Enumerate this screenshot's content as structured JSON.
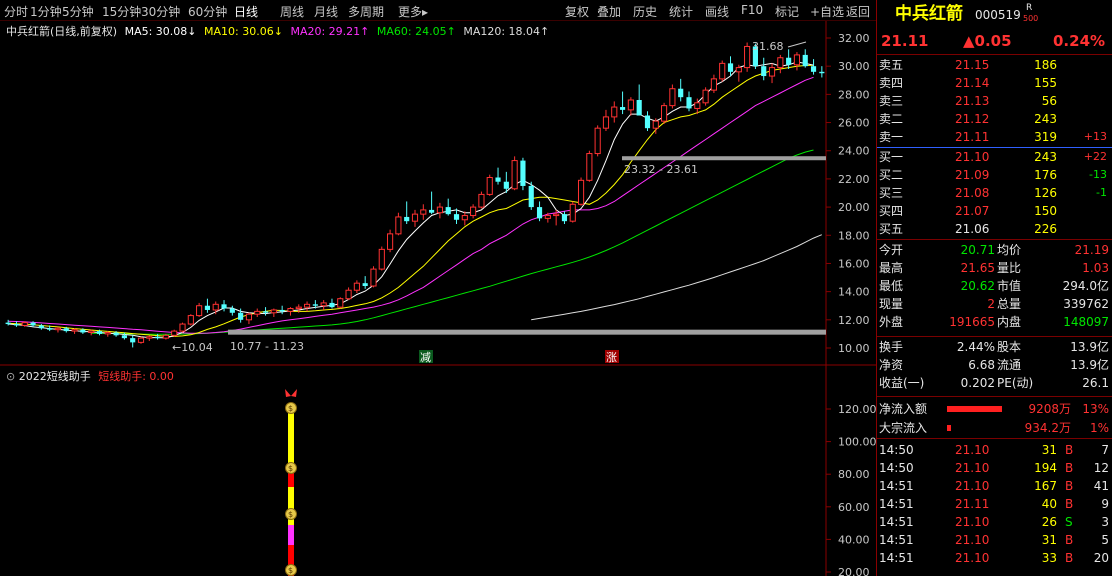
{
  "toolbar": {
    "periods": [
      "分时",
      "1分钟",
      "5分钟",
      "15分钟",
      "30分钟",
      "60分钟",
      "日线",
      "周线",
      "月线",
      "多周期",
      "更多▸"
    ],
    "active_period": "日线",
    "actions": [
      "复权",
      "叠加",
      "历史",
      "统计",
      "画线",
      "F10",
      "标记",
      "+自选",
      "返回"
    ]
  },
  "chart_header": {
    "name": "中兵红箭(日线,前复权)",
    "ma5": "MA5: 30.08↓",
    "ma10": "MA10: 30.06↓",
    "ma20": "MA20: 29.21↑",
    "ma60": "MA60: 24.05↑",
    "ma120": "MA120: 18.04↑"
  },
  "colors": {
    "ma5": "#ffffff",
    "ma10": "#ffff00",
    "ma20": "#ff32ff",
    "ma60": "#00e600",
    "ma120": "#dcdcdc",
    "up": "#ff3232",
    "down": "#54ffff",
    "grid": "#8a0000"
  },
  "price_axis": {
    "labels": [
      "32.00",
      "30.00",
      "28.00",
      "26.00",
      "24.00",
      "22.00",
      "20.00",
      "18.00",
      "16.00",
      "14.00",
      "12.00",
      "10.00"
    ]
  },
  "annotations": {
    "high_label": "31.68",
    "low_label": "10.04",
    "band_low": "10.77 - 11.23",
    "band_high": "23.32 - 23.61",
    "signal_decrease": "减",
    "signal_increase": "涨"
  },
  "candles": [
    [
      11.8,
      12.0,
      11.6,
      11.7
    ],
    [
      11.7,
      11.9,
      11.5,
      11.6
    ],
    [
      11.6,
      11.9,
      11.5,
      11.8
    ],
    [
      11.8,
      11.9,
      11.5,
      11.6
    ],
    [
      11.6,
      11.7,
      11.3,
      11.4
    ],
    [
      11.4,
      11.6,
      11.2,
      11.3
    ],
    [
      11.3,
      11.5,
      11.1,
      11.4
    ],
    [
      11.4,
      11.5,
      11.1,
      11.2
    ],
    [
      11.2,
      11.4,
      11.0,
      11.3
    ],
    [
      11.3,
      11.4,
      11.0,
      11.1
    ],
    [
      11.1,
      11.3,
      10.9,
      11.2
    ],
    [
      11.2,
      11.3,
      10.9,
      11.0
    ],
    [
      11.0,
      11.2,
      10.8,
      11.1
    ],
    [
      11.1,
      11.2,
      10.8,
      10.9
    ],
    [
      10.9,
      11.1,
      10.6,
      10.7
    ],
    [
      10.7,
      10.9,
      10.04,
      10.4
    ],
    [
      10.4,
      10.8,
      10.3,
      10.7
    ],
    [
      10.7,
      10.9,
      10.5,
      10.8
    ],
    [
      10.8,
      11.0,
      10.6,
      10.7
    ],
    [
      10.7,
      11.0,
      10.6,
      10.9
    ],
    [
      10.9,
      11.3,
      10.8,
      11.2
    ],
    [
      11.2,
      11.8,
      11.1,
      11.7
    ],
    [
      11.7,
      12.4,
      11.6,
      12.3
    ],
    [
      12.3,
      13.2,
      12.2,
      13.0
    ],
    [
      13.0,
      13.5,
      12.5,
      12.7
    ],
    [
      12.7,
      13.3,
      12.4,
      13.1
    ],
    [
      13.1,
      13.4,
      12.6,
      12.8
    ],
    [
      12.8,
      13.0,
      12.3,
      12.5
    ],
    [
      12.5,
      12.8,
      11.8,
      12.0
    ],
    [
      12.0,
      12.5,
      11.7,
      12.4
    ],
    [
      12.4,
      12.8,
      12.2,
      12.6
    ],
    [
      12.6,
      12.9,
      12.3,
      12.5
    ],
    [
      12.5,
      12.8,
      12.2,
      12.7
    ],
    [
      12.7,
      13.0,
      12.4,
      12.6
    ],
    [
      12.6,
      12.9,
      12.3,
      12.8
    ],
    [
      12.8,
      13.1,
      12.5,
      12.9
    ],
    [
      12.9,
      13.3,
      12.6,
      13.1
    ],
    [
      13.1,
      13.4,
      12.8,
      13.0
    ],
    [
      13.0,
      13.4,
      12.7,
      13.2
    ],
    [
      13.2,
      13.5,
      12.8,
      12.9
    ],
    [
      12.9,
      13.6,
      12.8,
      13.5
    ],
    [
      13.5,
      14.3,
      13.4,
      14.1
    ],
    [
      14.1,
      14.8,
      13.9,
      14.6
    ],
    [
      14.6,
      15.1,
      14.2,
      14.4
    ],
    [
      14.4,
      15.8,
      14.3,
      15.6
    ],
    [
      15.6,
      17.2,
      15.5,
      17.0
    ],
    [
      17.0,
      18.4,
      16.8,
      18.1
    ],
    [
      18.1,
      19.6,
      18.0,
      19.3
    ],
    [
      19.3,
      20.4,
      18.8,
      19.0
    ],
    [
      19.0,
      19.8,
      18.6,
      19.5
    ],
    [
      19.5,
      20.2,
      19.1,
      19.8
    ],
    [
      19.8,
      21.1,
      19.5,
      19.6
    ],
    [
      19.6,
      20.3,
      19.2,
      20.0
    ],
    [
      20.0,
      20.6,
      19.4,
      19.5
    ],
    [
      19.5,
      19.9,
      18.8,
      19.1
    ],
    [
      19.1,
      19.7,
      18.7,
      19.4
    ],
    [
      19.4,
      20.2,
      19.2,
      20.0
    ],
    [
      20.0,
      21.1,
      19.9,
      20.9
    ],
    [
      20.9,
      22.3,
      20.8,
      22.1
    ],
    [
      22.1,
      22.8,
      21.6,
      21.8
    ],
    [
      21.8,
      22.5,
      21.0,
      21.3
    ],
    [
      21.3,
      23.6,
      21.2,
      23.3
    ],
    [
      23.3,
      23.5,
      21.2,
      21.5
    ],
    [
      21.5,
      21.8,
      19.8,
      20.0
    ],
    [
      20.0,
      20.4,
      19.0,
      19.2
    ],
    [
      19.2,
      19.6,
      18.9,
      19.4
    ],
    [
      19.4,
      19.8,
      18.7,
      19.5
    ],
    [
      19.5,
      19.7,
      18.8,
      19.0
    ],
    [
      19.0,
      20.4,
      18.9,
      20.2
    ],
    [
      20.2,
      22.1,
      20.1,
      21.9
    ],
    [
      21.9,
      24.0,
      21.8,
      23.8
    ],
    [
      23.8,
      25.8,
      23.6,
      25.6
    ],
    [
      25.6,
      26.9,
      25.4,
      26.4
    ],
    [
      26.4,
      27.5,
      26.0,
      27.1
    ],
    [
      27.1,
      28.2,
      26.6,
      26.9
    ],
    [
      26.9,
      27.8,
      26.5,
      27.6
    ],
    [
      27.6,
      28.7,
      27.2,
      26.5
    ],
    [
      26.5,
      26.8,
      25.4,
      25.6
    ],
    [
      25.6,
      26.3,
      25.2,
      26.1
    ],
    [
      26.1,
      27.4,
      25.9,
      27.2
    ],
    [
      27.2,
      28.7,
      27.0,
      28.4
    ],
    [
      28.4,
      29.1,
      27.5,
      27.8
    ],
    [
      27.8,
      28.2,
      26.8,
      27.0
    ],
    [
      27.0,
      27.7,
      26.6,
      27.4
    ],
    [
      27.4,
      28.5,
      27.2,
      28.3
    ],
    [
      28.3,
      29.4,
      28.1,
      29.1
    ],
    [
      29.1,
      30.4,
      28.9,
      30.2
    ],
    [
      30.2,
      30.7,
      29.3,
      29.6
    ],
    [
      29.6,
      30.1,
      28.9,
      29.9
    ],
    [
      29.9,
      31.68,
      29.6,
      31.4
    ],
    [
      31.4,
      31.6,
      29.8,
      30.0
    ],
    [
      30.0,
      30.6,
      29.0,
      29.3
    ],
    [
      29.3,
      30.2,
      28.8,
      29.9
    ],
    [
      29.9,
      30.8,
      29.5,
      30.6
    ],
    [
      30.6,
      31.2,
      29.8,
      30.1
    ],
    [
      30.1,
      31.0,
      29.7,
      30.8
    ],
    [
      30.8,
      31.2,
      29.9,
      30.0
    ],
    [
      30.0,
      30.5,
      29.4,
      29.6
    ],
    [
      29.6,
      30.0,
      29.2,
      29.5
    ]
  ],
  "ma_lines": {
    "ma5": [
      11.7,
      11.66,
      11.6,
      11.5,
      11.45,
      11.38,
      11.32,
      11.27,
      11.22,
      11.18,
      11.14,
      11.1,
      11.06,
      11.02,
      10.96,
      10.9,
      10.8,
      10.74,
      10.74,
      10.72,
      10.88,
      11.1,
      11.46,
      11.96,
      12.3,
      12.56,
      12.84,
      12.84,
      12.6,
      12.5,
      12.46,
      12.44,
      12.52,
      12.56,
      12.64,
      12.7,
      12.8,
      12.88,
      12.96,
      13.02,
      13.14,
      13.44,
      13.8,
      14.04,
      14.46,
      15.06,
      15.96,
      16.9,
      17.7,
      18.3,
      18.88,
      19.4,
      19.6,
      19.7,
      19.8,
      19.6,
      19.6,
      19.8,
      20.3,
      20.8,
      21.1,
      21.6,
      21.9,
      21.6,
      21.2,
      20.7,
      19.8,
      19.4,
      19.5,
      19.9,
      20.7,
      21.9,
      23.3,
      24.8,
      25.9,
      26.6,
      26.6,
      26.3,
      26.1,
      26.4,
      26.8,
      27.1,
      27.1,
      27.4,
      28.0,
      28.6,
      28.9,
      29.3,
      29.9,
      30.1,
      30.0,
      30.1,
      30.2,
      30.0,
      30.1,
      30.3,
      30.2,
      30.08
    ],
    "ma10": [
      11.75,
      11.72,
      11.7,
      11.65,
      11.6,
      11.55,
      11.5,
      11.44,
      11.38,
      11.33,
      11.28,
      11.23,
      11.18,
      11.13,
      11.08,
      11.02,
      10.98,
      10.92,
      10.88,
      10.84,
      10.82,
      10.86,
      10.94,
      11.1,
      11.32,
      11.5,
      11.72,
      11.96,
      12.2,
      12.36,
      12.5,
      12.6,
      12.68,
      12.66,
      12.6,
      12.6,
      12.6,
      12.64,
      12.7,
      12.74,
      12.8,
      12.9,
      13.02,
      13.14,
      13.3,
      13.56,
      13.9,
      14.3,
      14.8,
      15.3,
      15.8,
      16.4,
      17.0,
      17.6,
      18.1,
      18.6,
      19.0,
      19.3,
      19.6,
      19.8,
      19.9,
      20.2,
      20.5,
      20.6,
      20.7,
      20.7,
      20.6,
      20.5,
      20.4,
      20.3,
      20.2,
      20.5,
      21.0,
      21.6,
      22.3,
      23.2,
      24.0,
      24.8,
      25.5,
      26.0,
      26.2,
      26.4,
      26.5,
      26.7,
      26.9,
      27.3,
      27.8,
      28.2,
      28.6,
      29.0,
      29.3,
      29.5,
      29.7,
      29.8,
      29.9,
      30.0,
      30.05,
      30.06
    ],
    "ma20": [
      11.9,
      11.88,
      11.85,
      11.82,
      11.78,
      11.74,
      11.7,
      11.66,
      11.62,
      11.58,
      11.54,
      11.5,
      11.46,
      11.42,
      11.38,
      11.33,
      11.29,
      11.24,
      11.19,
      11.14,
      11.1,
      11.07,
      11.04,
      11.04,
      11.06,
      11.1,
      11.16,
      11.24,
      11.34,
      11.46,
      11.58,
      11.7,
      11.82,
      11.92,
      12.0,
      12.08,
      12.16,
      12.24,
      12.32,
      12.4,
      12.5,
      12.6,
      12.7,
      12.8,
      12.9,
      13.04,
      13.2,
      13.42,
      13.7,
      14.0,
      14.3,
      14.7,
      15.1,
      15.5,
      15.9,
      16.3,
      16.7,
      17.0,
      17.4,
      17.7,
      18.0,
      18.4,
      18.8,
      19.1,
      19.3,
      19.5,
      19.6,
      19.7,
      19.8,
      19.8,
      19.8,
      19.9,
      20.1,
      20.4,
      20.8,
      21.2,
      21.6,
      22.0,
      22.4,
      22.8,
      23.2,
      23.6,
      24.0,
      24.4,
      24.8,
      25.2,
      25.6,
      26.0,
      26.4,
      26.8,
      27.2,
      27.5,
      27.8,
      28.1,
      28.4,
      28.7,
      29.0,
      29.21
    ],
    "ma60": [
      null,
      null,
      null,
      null,
      null,
      null,
      null,
      null,
      null,
      null,
      11.05,
      11.04,
      11.03,
      11.02,
      11.01,
      11.0,
      10.99,
      10.98,
      10.98,
      10.98,
      10.98,
      10.99,
      11.0,
      11.02,
      11.05,
      11.08,
      11.12,
      11.16,
      11.2,
      11.24,
      11.28,
      11.32,
      11.36,
      11.4,
      11.44,
      11.48,
      11.52,
      11.56,
      11.6,
      11.64,
      11.7,
      11.78,
      11.88,
      12.0,
      12.14,
      12.3,
      12.46,
      12.62,
      12.78,
      12.94,
      13.1,
      13.26,
      13.42,
      13.58,
      13.74,
      13.9,
      14.06,
      14.22,
      14.38,
      14.56,
      14.74,
      14.92,
      15.1,
      15.28,
      15.44,
      15.6,
      15.76,
      15.92,
      16.08,
      16.26,
      16.46,
      16.68,
      16.92,
      17.18,
      17.46,
      17.76,
      18.06,
      18.36,
      18.66,
      18.96,
      19.26,
      19.56,
      19.86,
      20.16,
      20.46,
      20.76,
      21.06,
      21.36,
      21.66,
      21.96,
      22.26,
      22.56,
      22.86,
      23.16,
      23.46,
      23.7,
      23.9,
      24.05
    ],
    "ma120": [
      null,
      null,
      null,
      null,
      null,
      null,
      null,
      null,
      null,
      null,
      null,
      null,
      null,
      null,
      null,
      null,
      null,
      null,
      null,
      null,
      null,
      null,
      null,
      null,
      null,
      null,
      null,
      null,
      null,
      null,
      null,
      null,
      null,
      null,
      null,
      null,
      null,
      null,
      null,
      null,
      null,
      null,
      null,
      null,
      null,
      null,
      null,
      null,
      null,
      null,
      null,
      null,
      null,
      null,
      null,
      null,
      null,
      null,
      null,
      null,
      null,
      null,
      null,
      12.0,
      12.1,
      12.2,
      12.3,
      12.4,
      12.5,
      12.6,
      12.72,
      12.84,
      12.96,
      13.08,
      13.22,
      13.36,
      13.5,
      13.66,
      13.82,
      13.98,
      14.14,
      14.3,
      14.46,
      14.64,
      14.82,
      15.0,
      15.2,
      15.4,
      15.6,
      15.8,
      16.0,
      16.2,
      16.45,
      16.7,
      16.95,
      17.2,
      17.5,
      17.8,
      18.04
    ]
  },
  "sub_chart": {
    "title": "2022短线助手",
    "indicator_label": "短线助手: 0.00",
    "axis_labels": [
      "120.00",
      "100.00",
      "80.00",
      "60.00",
      "40.00",
      "20.00"
    ]
  },
  "quote": {
    "name": "中兵红箭",
    "code": "000519",
    "badge_top": "R",
    "badge_bottom": "500",
    "price": "21.11",
    "change": "▲0.05",
    "change_pct": "0.24%",
    "asks": [
      {
        "label": "卖五",
        "price": "21.15",
        "vol": "186",
        "chg": ""
      },
      {
        "label": "卖四",
        "price": "21.14",
        "vol": "155",
        "chg": ""
      },
      {
        "label": "卖三",
        "price": "21.13",
        "vol": "56",
        "chg": ""
      },
      {
        "label": "卖二",
        "price": "21.12",
        "vol": "243",
        "chg": ""
      },
      {
        "label": "卖一",
        "price": "21.11",
        "vol": "319",
        "chg": "+13"
      }
    ],
    "bids": [
      {
        "label": "买一",
        "price": "21.10",
        "vol": "243",
        "chg": "+22"
      },
      {
        "label": "买二",
        "price": "21.09",
        "vol": "176",
        "chg": "-13"
      },
      {
        "label": "买三",
        "price": "21.08",
        "vol": "126",
        "chg": "-1"
      },
      {
        "label": "买四",
        "price": "21.07",
        "vol": "150",
        "chg": ""
      },
      {
        "label": "买五",
        "price": "21.06",
        "vol": "226",
        "chg": ""
      }
    ],
    "stats": [
      {
        "l1": "今开",
        "v1": "20.71",
        "c1": "green",
        "l2": "均价",
        "v2": "21.19",
        "c2": "red"
      },
      {
        "l1": "最高",
        "v1": "21.65",
        "c1": "red",
        "l2": "量比",
        "v2": "1.03",
        "c2": "red"
      },
      {
        "l1": "最低",
        "v1": "20.62",
        "c1": "green",
        "l2": "市值",
        "v2": "294.0亿",
        "c2": "white"
      },
      {
        "l1": "现量",
        "v1": "2",
        "c1": "red",
        "l2": "总量",
        "v2": "339762",
        "c2": "white"
      },
      {
        "l1": "外盘",
        "v1": "191665",
        "c1": "red",
        "l2": "内盘",
        "v2": "148097",
        "c2": "green"
      }
    ],
    "fundamentals": [
      {
        "l1": "换手",
        "v1": "2.44%",
        "l2": "股本",
        "v2": "13.9亿"
      },
      {
        "l1": "净资",
        "v1": "6.68",
        "l2": "流通",
        "v2": "13.9亿"
      },
      {
        "l1": "收益(一)",
        "v1": "0.202",
        "l2": "PE(动)",
        "v2": "26.1"
      }
    ],
    "flows": [
      {
        "label": "净流入额",
        "amount": "9208万",
        "pct": "13%",
        "bar": 0.13
      },
      {
        "label": "大宗流入",
        "amount": "934.2万",
        "pct": "1%",
        "bar": 0.01
      }
    ],
    "ticks": [
      {
        "time": "14:50",
        "price": "21.10",
        "vol": "31",
        "side": "B",
        "count": "7"
      },
      {
        "time": "14:50",
        "price": "21.10",
        "vol": "194",
        "side": "B",
        "count": "12"
      },
      {
        "time": "14:51",
        "price": "21.10",
        "vol": "167",
        "side": "B",
        "count": "41"
      },
      {
        "time": "14:51",
        "price": "21.11",
        "vol": "40",
        "side": "B",
        "count": "9"
      },
      {
        "time": "14:51",
        "price": "21.10",
        "vol": "26",
        "side": "S",
        "count": "3"
      },
      {
        "time": "14:51",
        "price": "21.10",
        "vol": "31",
        "side": "B",
        "count": "5"
      },
      {
        "time": "14:51",
        "price": "21.10",
        "vol": "33",
        "side": "B",
        "count": "20"
      }
    ]
  }
}
